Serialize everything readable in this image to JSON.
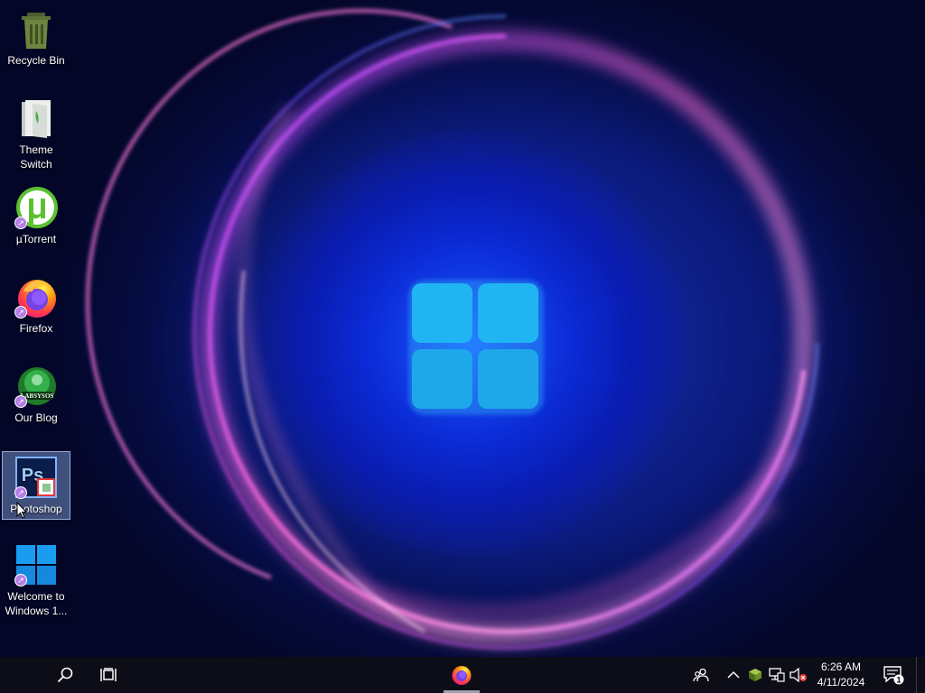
{
  "desktop": {
    "icons": [
      {
        "label": "Recycle Bin",
        "icon": "recycle-bin-icon",
        "shortcut": false
      },
      {
        "label": "Theme Switch",
        "icon": "theme-switch-icon",
        "shortcut": false
      },
      {
        "label": "µTorrent",
        "icon": "utorrent-icon",
        "shortcut": true
      },
      {
        "label": "Firefox",
        "icon": "firefox-icon",
        "shortcut": true
      },
      {
        "label": "Our Blog",
        "icon": "labsysos-icon",
        "icon_text": "LABSYSOS",
        "shortcut": true
      },
      {
        "label": "Photoshop",
        "icon": "photoshop-icon",
        "icon_text": "Ps",
        "shortcut": true,
        "selected": true
      },
      {
        "label": "Welcome to Windows 1...",
        "icon": "windows-logo-icon",
        "shortcut": true
      }
    ]
  },
  "taskbar": {
    "search_icon": "search-icon",
    "task_view_icon": "task-view-icon",
    "pinned": [
      {
        "name": "Firefox",
        "icon": "firefox-icon",
        "active": true
      }
    ],
    "tray": {
      "icons": [
        "people-icon",
        "chevron-up-icon",
        "app-tray-icon",
        "network-icon",
        "volume-muted-icon"
      ],
      "time": "6:26 AM",
      "date": "4/11/2024",
      "notifications_count": "1"
    }
  },
  "colors": {
    "taskbar": "#0d0d17",
    "wallpaper_center": "#1a56ff",
    "windows_logo": "#22b6f0",
    "glow_pink": "#ff5ad8",
    "glow_purple": "#9a3cff"
  }
}
